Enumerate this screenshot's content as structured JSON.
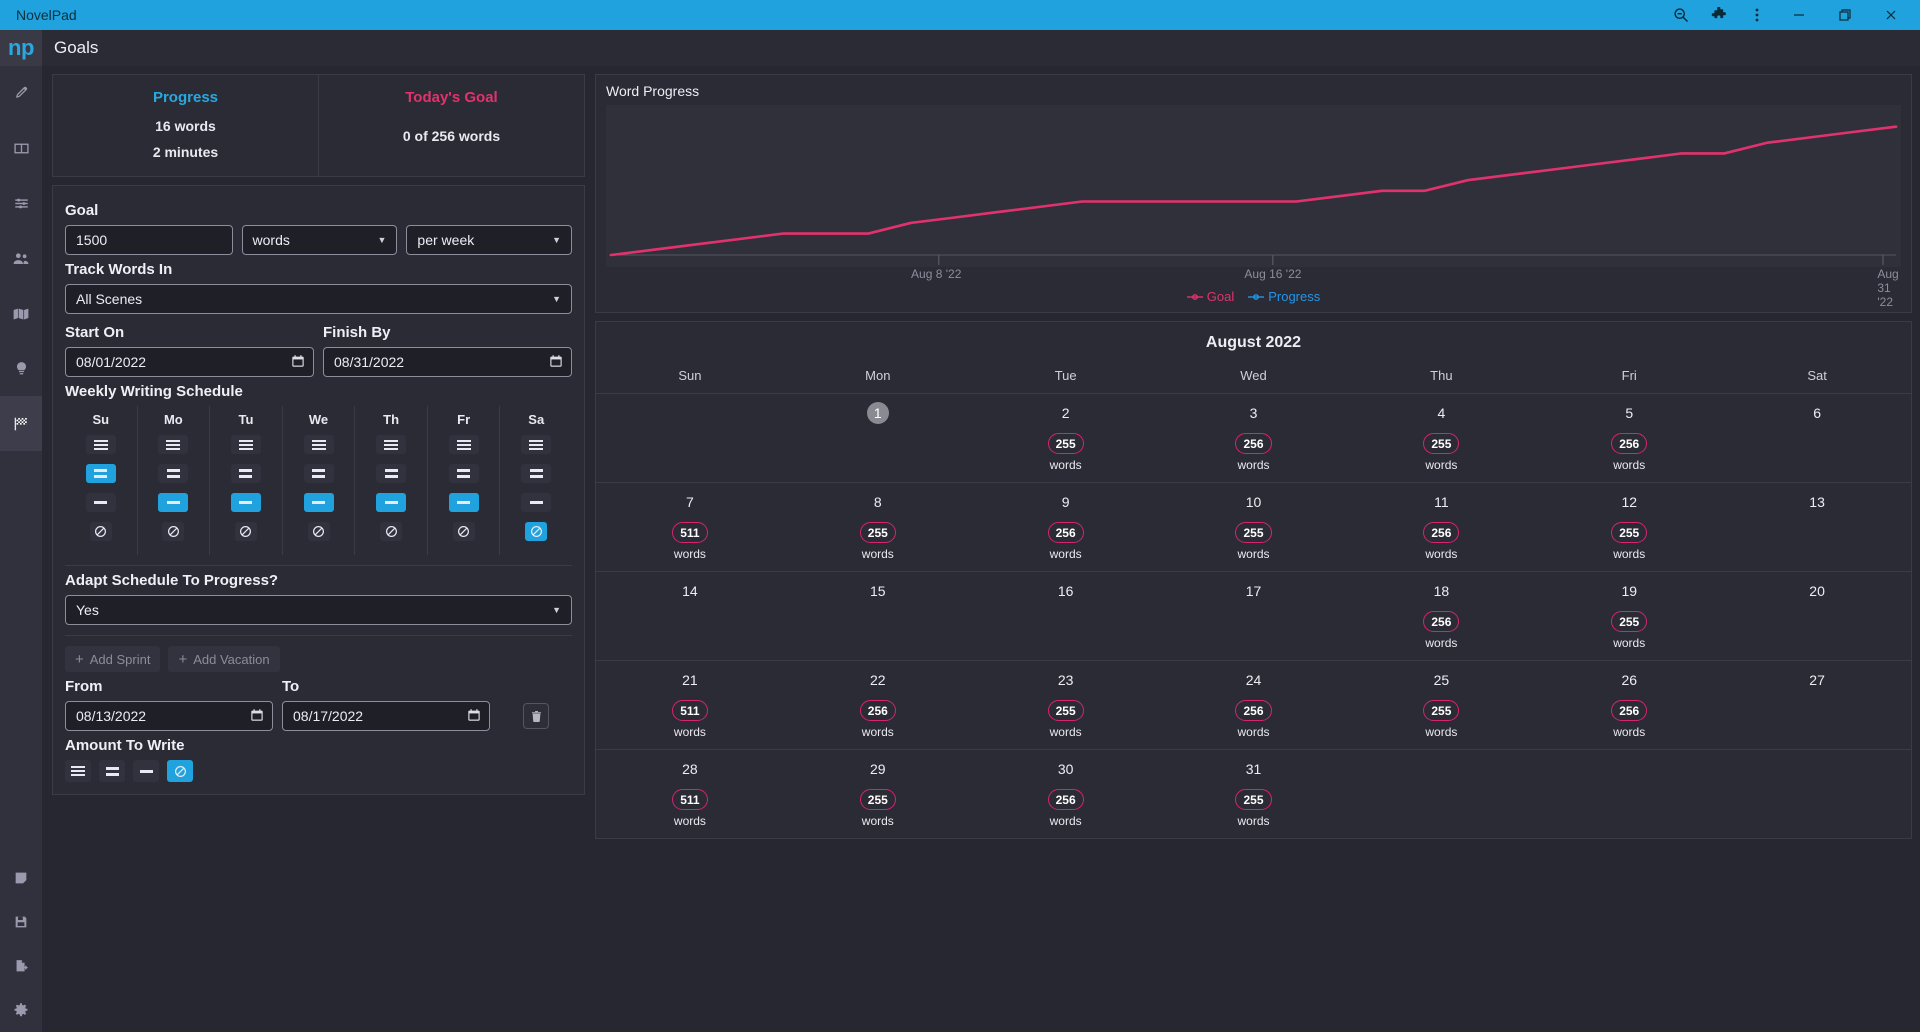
{
  "titlebar": {
    "app_title": "NovelPad",
    "accent": "#1fa2dd",
    "buttons": [
      {
        "name": "zoom-out-icon",
        "label": "Zoom out"
      },
      {
        "name": "extensions-icon",
        "label": "Extensions"
      },
      {
        "name": "overflow-menu-icon",
        "label": "More"
      },
      {
        "name": "minimize-icon",
        "label": "Minimize"
      },
      {
        "name": "maximize-icon",
        "label": "Maximize"
      },
      {
        "name": "close-icon",
        "label": "Close"
      }
    ]
  },
  "rail": {
    "logo": "np",
    "items": [
      {
        "icon": "pen-icon",
        "label": "Write"
      },
      {
        "icon": "board-icon",
        "label": "Board"
      },
      {
        "icon": "timeline-icon",
        "label": "Timeline"
      },
      {
        "icon": "characters-icon",
        "label": "Characters"
      },
      {
        "icon": "locations-icon",
        "label": "Locations"
      },
      {
        "icon": "ideas-icon",
        "label": "Ideas"
      },
      {
        "icon": "goals-flag-icon",
        "label": "Goals",
        "active": true
      }
    ],
    "bottom_items": [
      {
        "icon": "notes-icon",
        "label": "Notes"
      },
      {
        "icon": "save-icon",
        "label": "Save"
      },
      {
        "icon": "export-icon",
        "label": "Export"
      },
      {
        "icon": "settings-gear-icon",
        "label": "Settings"
      }
    ]
  },
  "header": {
    "title": "Goals"
  },
  "stats": {
    "progress": {
      "title": "Progress",
      "title_color": "#29a8e0",
      "words": "16 words",
      "minutes": "2 minutes"
    },
    "todays_goal": {
      "title": "Today's Goal",
      "title_color": "#e2326d",
      "value": "0 of 256 words"
    }
  },
  "form": {
    "goal_label": "Goal",
    "goal_amount": "1500",
    "goal_units": "words",
    "goal_period": "per week",
    "track_label": "Track Words In",
    "track_value": "All Scenes",
    "start_label": "Start On",
    "start_value": "08/01/2022",
    "finish_label": "Finish By",
    "finish_value": "08/31/2022",
    "schedule_label": "Weekly Writing Schedule",
    "days": [
      {
        "abbr": "Su",
        "selected": 1
      },
      {
        "abbr": "Mo",
        "selected": 2
      },
      {
        "abbr": "Tu",
        "selected": 2
      },
      {
        "abbr": "We",
        "selected": 2
      },
      {
        "abbr": "Th",
        "selected": 2
      },
      {
        "abbr": "Fr",
        "selected": 2
      },
      {
        "abbr": "Sa",
        "selected": 3
      }
    ],
    "adapt_label": "Adapt Schedule To Progress?",
    "adapt_value": "Yes",
    "add_sprint_label": "Add Sprint",
    "add_vacation_label": "Add Vacation",
    "from_label": "From",
    "from_value": "08/13/2022",
    "to_label": "To",
    "to_value": "08/17/2022",
    "amount_label": "Amount To Write",
    "amount_selected": 3
  },
  "chart_data": {
    "type": "line",
    "title": "Word Progress",
    "xlabel": "",
    "ylabel": "",
    "grid": false,
    "legend_position": "bottom-center",
    "tick_labels": [
      "Aug 8 '22",
      "Aug 16 '22",
      "Aug 31 '22"
    ],
    "tick_positions_pct": [
      25.5,
      51.5,
      99.0
    ],
    "series": [
      {
        "name": "Goal",
        "color": "#e2326d",
        "x": [
          "Aug 1 '22",
          "Aug 2 '22",
          "Aug 3 '22",
          "Aug 4 '22",
          "Aug 5 '22",
          "Aug 6 '22",
          "Aug 7 '22",
          "Aug 8 '22",
          "Aug 9 '22",
          "Aug 10 '22",
          "Aug 11 '22",
          "Aug 12 '22",
          "Aug 13 '22",
          "Aug 14 '22",
          "Aug 15 '22",
          "Aug 16 '22",
          "Aug 17 '22",
          "Aug 18 '22",
          "Aug 19 '22",
          "Aug 20 '22",
          "Aug 21 '22",
          "Aug 22 '22",
          "Aug 23 '22",
          "Aug 24 '22",
          "Aug 25 '22",
          "Aug 26 '22",
          "Aug 27 '22",
          "Aug 28 '22",
          "Aug 29 '22",
          "Aug 30 '22",
          "Aug 31 '22"
        ],
        "values": [
          0,
          255,
          511,
          766,
          1022,
          1022,
          1022,
          1533,
          1789,
          2044,
          2300,
          2555,
          2555,
          2555,
          2555,
          2555,
          2555,
          2811,
          3066,
          3066,
          3577,
          3833,
          4088,
          4344,
          4599,
          4855,
          4855,
          5366,
          5621,
          5877,
          6132
        ]
      },
      {
        "name": "Progress",
        "color": "#2196e8",
        "x": [
          "Aug 1 '22"
        ],
        "values": [
          16
        ]
      }
    ],
    "ylim": [
      0,
      6500
    ],
    "legend": [
      "Goal",
      "Progress"
    ]
  },
  "calendar": {
    "month": "August 2022",
    "weekdays": [
      "Sun",
      "Mon",
      "Tue",
      "Wed",
      "Thu",
      "Fri",
      "Sat"
    ],
    "words_suffix": "words",
    "weeks": [
      [
        {
          "day": "",
          "words": ""
        },
        {
          "day": "1",
          "words": "",
          "today": true
        },
        {
          "day": "2",
          "words": "255"
        },
        {
          "day": "3",
          "words": "256"
        },
        {
          "day": "4",
          "words": "255"
        },
        {
          "day": "5",
          "words": "256"
        },
        {
          "day": "6",
          "words": ""
        }
      ],
      [
        {
          "day": "7",
          "words": "511"
        },
        {
          "day": "8",
          "words": "255"
        },
        {
          "day": "9",
          "words": "256"
        },
        {
          "day": "10",
          "words": "255"
        },
        {
          "day": "11",
          "words": "256"
        },
        {
          "day": "12",
          "words": "255"
        },
        {
          "day": "13",
          "words": ""
        }
      ],
      [
        {
          "day": "14",
          "words": ""
        },
        {
          "day": "15",
          "words": ""
        },
        {
          "day": "16",
          "words": ""
        },
        {
          "day": "17",
          "words": ""
        },
        {
          "day": "18",
          "words": "256"
        },
        {
          "day": "19",
          "words": "255"
        },
        {
          "day": "20",
          "words": ""
        }
      ],
      [
        {
          "day": "21",
          "words": "511"
        },
        {
          "day": "22",
          "words": "256"
        },
        {
          "day": "23",
          "words": "255"
        },
        {
          "day": "24",
          "words": "256"
        },
        {
          "day": "25",
          "words": "255"
        },
        {
          "day": "26",
          "words": "256"
        },
        {
          "day": "27",
          "words": ""
        }
      ],
      [
        {
          "day": "28",
          "words": "511"
        },
        {
          "day": "29",
          "words": "255"
        },
        {
          "day": "30",
          "words": "256"
        },
        {
          "day": "31",
          "words": "255"
        },
        {
          "day": "",
          "words": ""
        },
        {
          "day": "",
          "words": ""
        },
        {
          "day": "",
          "words": ""
        }
      ]
    ]
  }
}
